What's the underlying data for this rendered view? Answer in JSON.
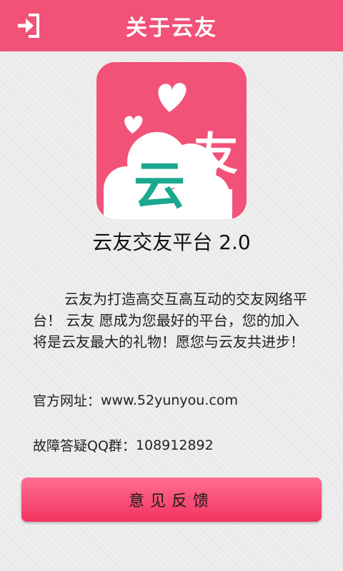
{
  "header": {
    "title": "关于云友",
    "back_icon": "exit-icon"
  },
  "logo": {
    "main_char": "云",
    "secondary_char": "友",
    "icon_name": "cloud-hearts-logo",
    "colors": {
      "background": "#f25278",
      "cloud": "#ffffff",
      "main_char": "#1aa88f",
      "secondary_char": "#ffffff"
    }
  },
  "app": {
    "name": "云友交友平台  2.0"
  },
  "description": "云友为打造高交互高互动的交友网络平台！ 云友 愿成为您最好的平台，您的加入将是云友最大的礼物！愿您与云友共进步！",
  "info": {
    "website_label": "官方网址：",
    "website_value": "www.52yunyou.com",
    "qq_label": "故障答疑QQ群：",
    "qq_value": "108912892"
  },
  "feedback": {
    "label": "意见反馈"
  },
  "colors": {
    "accent": "#f25278",
    "background": "#eeeeee"
  }
}
